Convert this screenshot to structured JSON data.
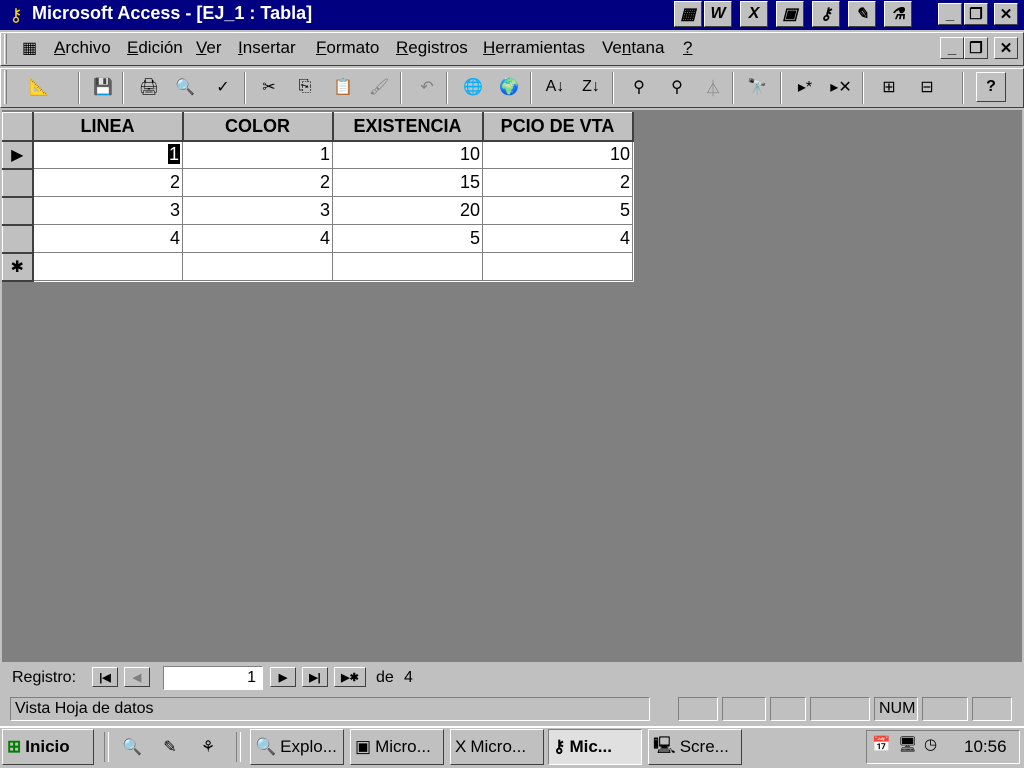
{
  "window": {
    "title": "Microsoft Access - [EJ_1 : Tabla]",
    "app_icon": "key-icon",
    "office_shortcuts": [
      "office-icon",
      "word-icon",
      "excel-icon",
      "powerpoint-icon",
      "access-icon",
      "outlook-icon",
      "binder-icon"
    ],
    "office_shortcut_glyphs": [
      "▦",
      "W",
      "X",
      "▣",
      "⚷",
      "✎",
      "⚗"
    ]
  },
  "menu": {
    "items": [
      {
        "label": "Archivo",
        "accel": "A"
      },
      {
        "label": "Edición",
        "accel": "E"
      },
      {
        "label": "Ver",
        "accel": "V"
      },
      {
        "label": "Insertar",
        "accel": "I"
      },
      {
        "label": "Formato",
        "accel": "F"
      },
      {
        "label": "Registros",
        "accel": "R"
      },
      {
        "label": "Herramientas",
        "accel": "H"
      },
      {
        "label": "Ventana",
        "accel": "n"
      },
      {
        "label": "?",
        "accel": "?"
      }
    ]
  },
  "toolbar": {
    "icons": [
      "view-icon",
      "save-icon",
      "print-icon",
      "print-preview-icon",
      "spelling-icon",
      "cut-icon",
      "copy-icon",
      "paste-icon",
      "format-painter-icon",
      "undo-icon",
      "insert-hyperlink-icon",
      "web-toolbar-icon",
      "sort-ascending-icon",
      "sort-descending-icon",
      "filter-by-selection-icon",
      "filter-by-form-icon",
      "apply-filter-icon",
      "find-icon",
      "new-record-icon",
      "delete-record-icon",
      "database-window-icon",
      "new-object-icon",
      "help-icon"
    ],
    "glyphs": [
      "📐",
      "💾",
      "🖨",
      "🔍",
      "✓",
      "✂",
      "⎘",
      "📋",
      "🖌",
      "↶",
      "🌐",
      "🌍",
      "A↓",
      "Z↓",
      "⚲",
      "⚲",
      "⏃",
      "🔭",
      "▸*",
      "▸✕",
      "⊞",
      "⊟",
      "?"
    ]
  },
  "datasheet": {
    "columns": [
      "LINEA",
      "COLOR",
      "EXISTENCIA",
      "PCIO DE VTA"
    ],
    "rows": [
      [
        "1",
        "1",
        "10",
        "10"
      ],
      [
        "2",
        "2",
        "15",
        "2"
      ],
      [
        "3",
        "3",
        "20",
        "5"
      ],
      [
        "4",
        "4",
        "5",
        "4"
      ]
    ],
    "current_row_marker": "▶",
    "new_row_marker": "✱"
  },
  "navigation": {
    "label": "Registro:",
    "current": "1",
    "of_label": "de",
    "total": "4"
  },
  "statusbar": {
    "text": "Vista Hoja de datos",
    "num": "NUM"
  },
  "taskbar": {
    "start_label": "Inicio",
    "tasks": [
      {
        "label": "Explo...",
        "icon": "explorer-icon",
        "active": false
      },
      {
        "label": "Micro...",
        "icon": "powerpoint-icon",
        "active": false
      },
      {
        "label": "Micro...",
        "icon": "excel-icon",
        "active": false
      },
      {
        "label": "Mic...",
        "icon": "access-icon",
        "active": true
      },
      {
        "label": "Scre...",
        "icon": "screen-icon",
        "active": false
      }
    ],
    "clock": "10:56"
  }
}
